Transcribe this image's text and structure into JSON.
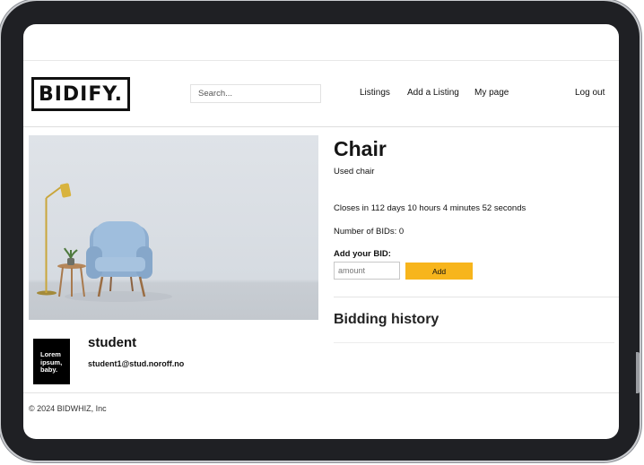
{
  "header": {
    "logo": "BIDIFY.",
    "search_placeholder": "Search...",
    "nav": {
      "listings": "Listings",
      "add_listing": "Add a Listing",
      "my_page": "My page",
      "logout": "Log out"
    }
  },
  "listing": {
    "title": "Chair",
    "description": "Used chair",
    "closes_text": "Closes in 112 days 10 hours 4 minutes 52 seconds",
    "bid_count_text": "Number of BIDs: 0",
    "add_bid_label": "Add your BID:",
    "amount_placeholder": "amount",
    "add_button": "Add",
    "bidding_history_title": "Bidding history",
    "image_alt": "Light blue armchair with side table and floor lamp"
  },
  "seller": {
    "avatar_text": "Lorem\nipsum,\nbaby.",
    "name": "student",
    "email": "student1@stud.noroff.no"
  },
  "footer": {
    "copyright": "© 2024 BIDWHIZ, Inc"
  },
  "colors": {
    "accent_button": "#f7b51c",
    "frame": "#1f2024"
  }
}
